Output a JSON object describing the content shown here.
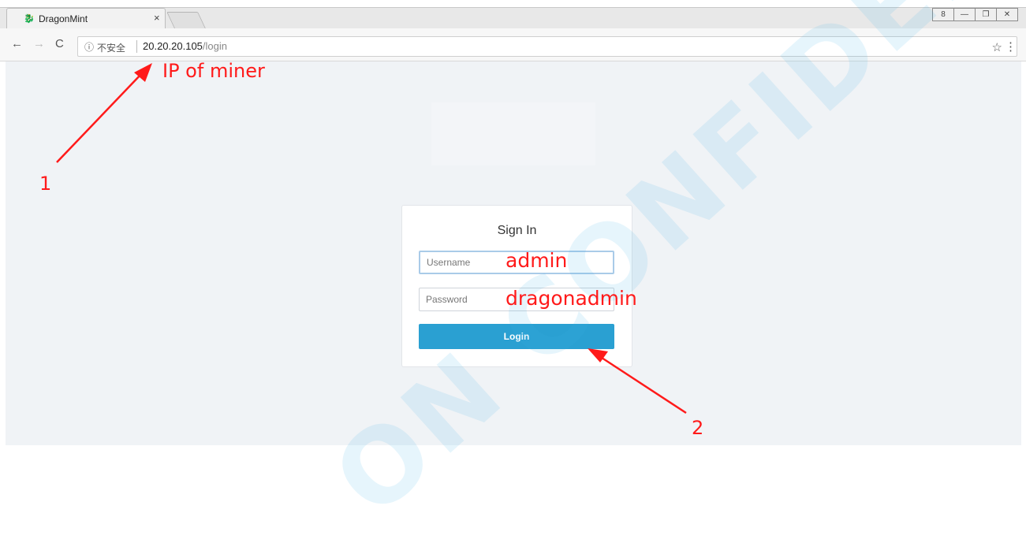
{
  "browser": {
    "tab_title": "DragonMint",
    "tab_close": "×",
    "security_label": "不安全",
    "url_host": "20.20.20.105",
    "url_path": "/login",
    "window_controls": [
      "8",
      "—",
      "❐",
      "✕"
    ]
  },
  "login": {
    "title": "Sign In",
    "username_placeholder": "Username",
    "password_placeholder": "Password",
    "login_label": "Login"
  },
  "annotations": {
    "ip_label": "IP of miner",
    "step1": "1",
    "step2": "2",
    "username_hint": "admin",
    "password_hint": "dragonadmin"
  },
  "watermark": "ON CONFIDENTIAL",
  "colors": {
    "accent": "#2aa0d2",
    "annotation": "#ff1a1a",
    "page_bg": "#f0f3f6"
  }
}
